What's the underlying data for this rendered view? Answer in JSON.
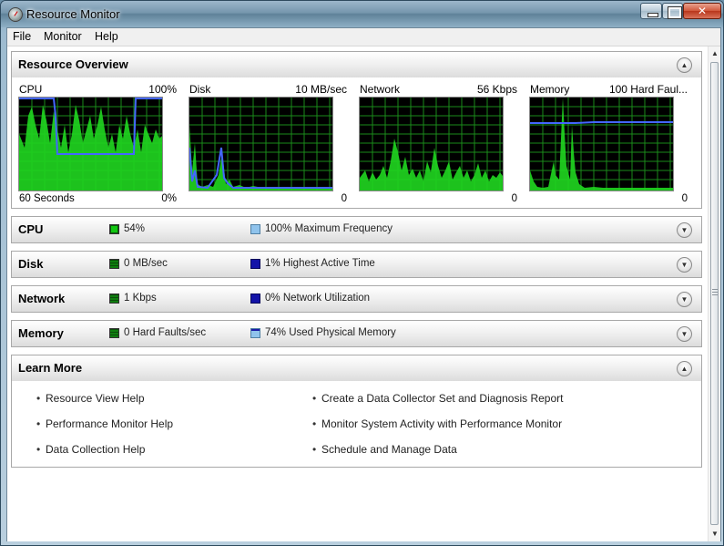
{
  "window": {
    "title": "Resource Monitor"
  },
  "menu": {
    "file": "File",
    "monitor": "Monitor",
    "help": "Help"
  },
  "overview": {
    "title": "Resource Overview",
    "graphs": [
      {
        "title": "CPU",
        "max": "100%",
        "bottom_left": "60 Seconds",
        "bottom_right": "0%"
      },
      {
        "title": "Disk",
        "max": "10 MB/sec",
        "bottom_left": "",
        "bottom_right": "0"
      },
      {
        "title": "Network",
        "max": "56 Kbps",
        "bottom_left": "",
        "bottom_right": "0"
      },
      {
        "title": "Memory",
        "max": "100 Hard Faul...",
        "bottom_left": "",
        "bottom_right": "0"
      }
    ]
  },
  "sections": {
    "cpu": {
      "title": "CPU",
      "stat1": "54%",
      "stat2": "100% Maximum Frequency"
    },
    "disk": {
      "title": "Disk",
      "stat1": "0 MB/sec",
      "stat2": "1% Highest Active Time"
    },
    "network": {
      "title": "Network",
      "stat1": "1 Kbps",
      "stat2": "0% Network Utilization"
    },
    "memory": {
      "title": "Memory",
      "stat1": "0 Hard Faults/sec",
      "stat2": "74% Used Physical Memory"
    }
  },
  "learn_more": {
    "title": "Learn More",
    "left": [
      "Resource View Help",
      "Performance Monitor Help",
      "Data Collection Help"
    ],
    "right": [
      "Create a Data Collector Set and Diagnosis Report",
      "Monitor System Activity with Performance Monitor",
      "Schedule and Manage Data"
    ]
  },
  "colors": {
    "graph_fill": "#1fd21f",
    "graph_line": "#4466ff",
    "grid": "#1a8a1a"
  },
  "icons": {
    "app": "resource-monitor-icon",
    "collapse": "chevron-up-icon",
    "expand": "chevron-down-icon"
  }
}
